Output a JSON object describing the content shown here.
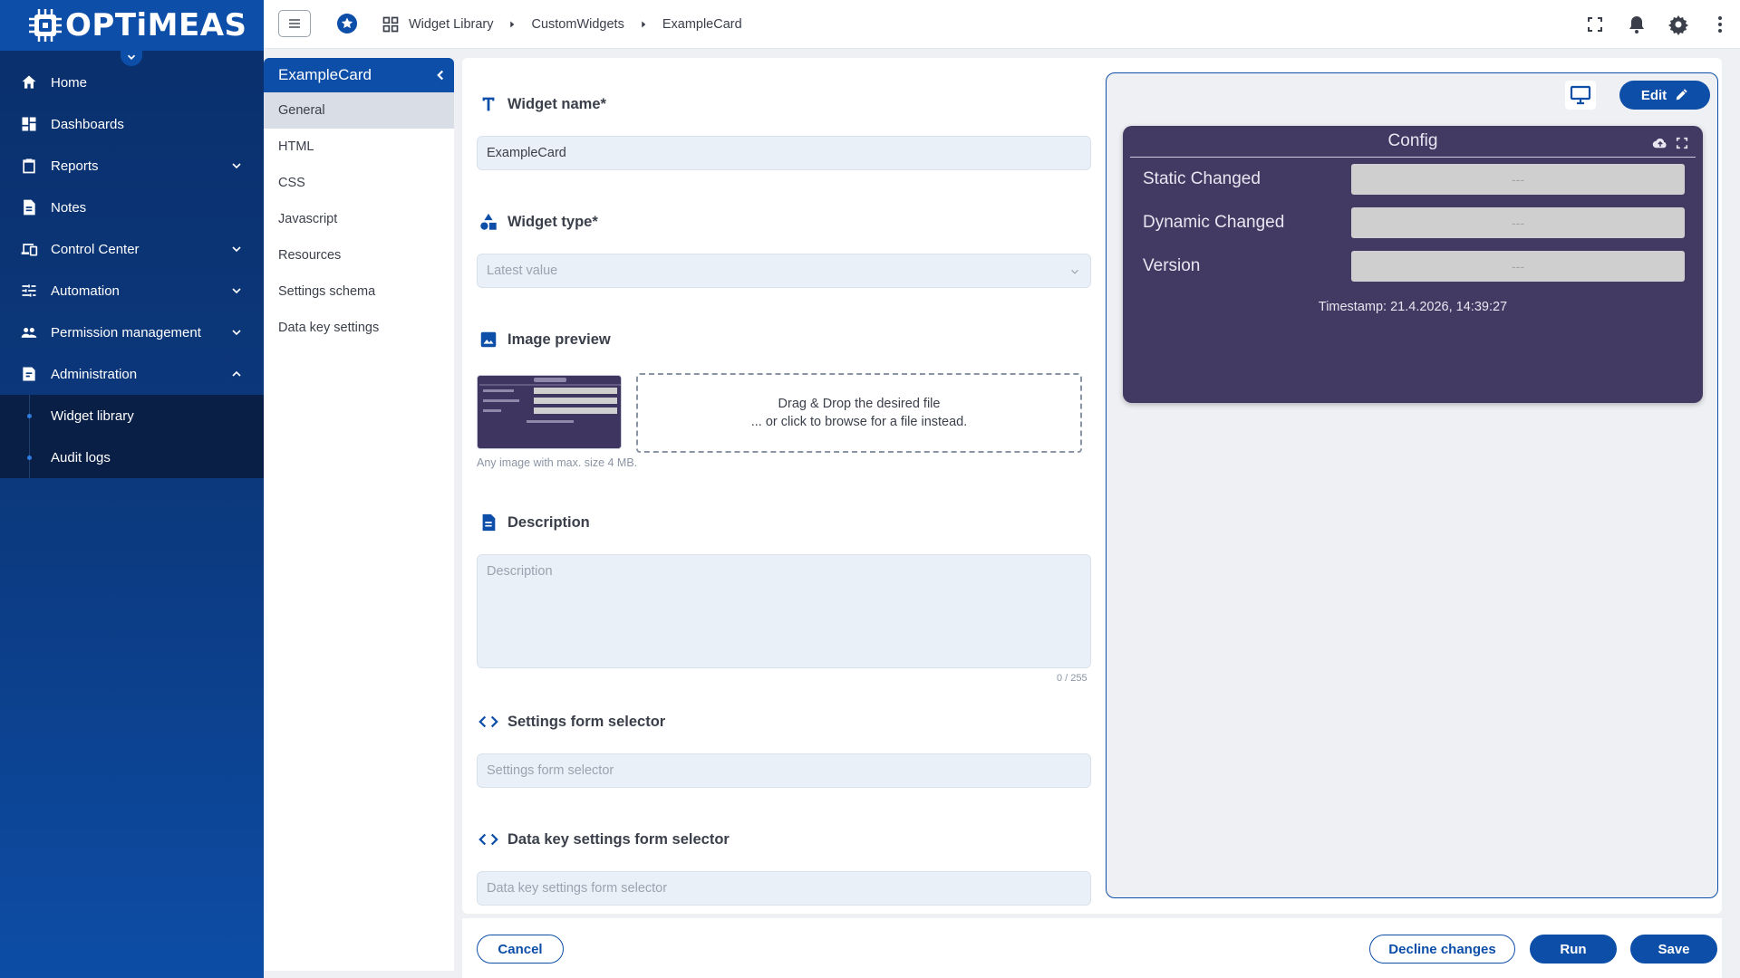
{
  "app": {
    "logo_text": "OPTiMEAS"
  },
  "nav": {
    "items": [
      {
        "label": "Home",
        "icon": "home-icon"
      },
      {
        "label": "Dashboards",
        "icon": "dashboard-icon"
      },
      {
        "label": "Reports",
        "icon": "clipboard-icon"
      },
      {
        "label": "Notes",
        "icon": "note-icon"
      },
      {
        "label": "Control Center",
        "icon": "devices-icon"
      },
      {
        "label": "Automation",
        "icon": "tune-icon"
      },
      {
        "label": "Permission management",
        "icon": "people-icon"
      },
      {
        "label": "Administration",
        "icon": "admin-icon"
      }
    ],
    "sub_items": [
      {
        "label": "Widget library"
      },
      {
        "label": "Audit logs"
      }
    ]
  },
  "breadcrumb": [
    "Widget Library",
    "CustomWidgets",
    "ExampleCard"
  ],
  "tabs": {
    "title": "ExampleCard",
    "items": [
      "General",
      "HTML",
      "CSS",
      "Javascript",
      "Resources",
      "Settings schema",
      "Data key settings"
    ],
    "active_index": 0
  },
  "form": {
    "widget_name": {
      "label": "Widget name*",
      "value": "ExampleCard"
    },
    "widget_type": {
      "label": "Widget type*",
      "placeholder": "Latest value"
    },
    "image_preview": {
      "label": "Image preview",
      "drop_line1": "Drag & Drop the desired file",
      "drop_line2": "... or click to browse for a file instead.",
      "hint": "Any image with max. size 4 MB."
    },
    "description": {
      "label": "Description",
      "placeholder": "Description",
      "counter": "0 / 255"
    },
    "settings_form_selector": {
      "label": "Settings form selector",
      "placeholder": "Settings form selector"
    },
    "data_key_settings_form_selector": {
      "label": "Data key settings form selector",
      "placeholder": "Data key settings form selector"
    }
  },
  "preview": {
    "edit_label": "Edit",
    "card": {
      "title": "Config",
      "rows": [
        {
          "label": "Static Changed",
          "value": "---"
        },
        {
          "label": "Dynamic Changed",
          "value": "---"
        },
        {
          "label": "Version",
          "value": "---"
        }
      ],
      "timestamp": "Timestamp: 21.4.2026, 14:39:27"
    }
  },
  "footer": {
    "cancel_label": "Cancel",
    "decline_label": "Decline changes",
    "run_label": "Run",
    "save_label": "Save"
  },
  "colors": {
    "brand": "#0d4ea8",
    "nav_dark": "#0a2f6b",
    "card_bg": "#433a63"
  }
}
